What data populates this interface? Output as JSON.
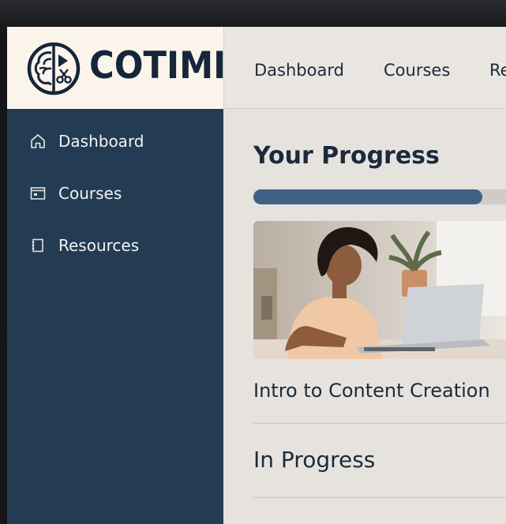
{
  "brand": {
    "name": "COTIMI"
  },
  "topnav": {
    "items": [
      {
        "label": "Dashboard"
      },
      {
        "label": "Courses"
      },
      {
        "label": "Re"
      }
    ]
  },
  "sidebar": {
    "items": [
      {
        "label": "Dashboard",
        "icon": "home-icon"
      },
      {
        "label": "Courses",
        "icon": "window-icon"
      },
      {
        "label": "Resources",
        "icon": "notebook-icon"
      }
    ]
  },
  "main": {
    "progress_title": "Your Progress",
    "progress_fraction": 0.88,
    "course_title": "Intro to Content Creation",
    "section_title": "In Progress"
  },
  "colors": {
    "sidebar": "#233c54",
    "logo_bg": "#faf4ea",
    "accent": "#3f6284",
    "text_dark": "#1c2a3b"
  }
}
